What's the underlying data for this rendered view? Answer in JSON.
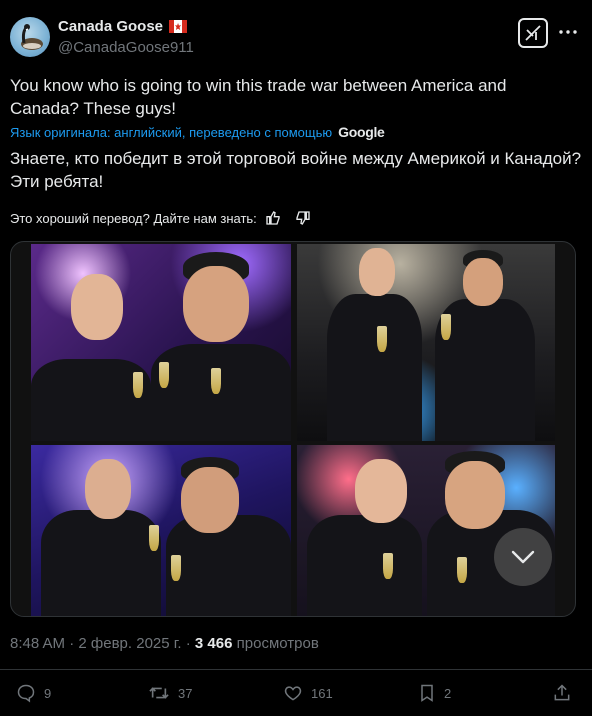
{
  "author": {
    "display_name": "Canada Goose",
    "handle": "@CanadaGoose911",
    "flag_icon": "canada-flag-icon"
  },
  "tweet": {
    "text": "You know who is going to win this trade war between America and Canada? These guys!",
    "translation_note": "Язык оригинала: английский, переведено с помощью",
    "translation_provider": "Google",
    "translated_text": "Знаете, кто победит в этой торговой войне между Америкой и Канадой? Эти ребята!",
    "feedback_prompt": "Это хороший перевод? Дайте нам знать:"
  },
  "meta": {
    "time": "8:48 AM",
    "date": "2 февр. 2025 г.",
    "views_count": "3 466",
    "views_label": "просмотров"
  },
  "actions": {
    "replies": "9",
    "reposts": "37",
    "likes": "161",
    "bookmarks": "2"
  },
  "colors": {
    "background": "#000000",
    "text": "#e7e9ea",
    "secondary": "#71767b",
    "link": "#1d9bf0"
  }
}
